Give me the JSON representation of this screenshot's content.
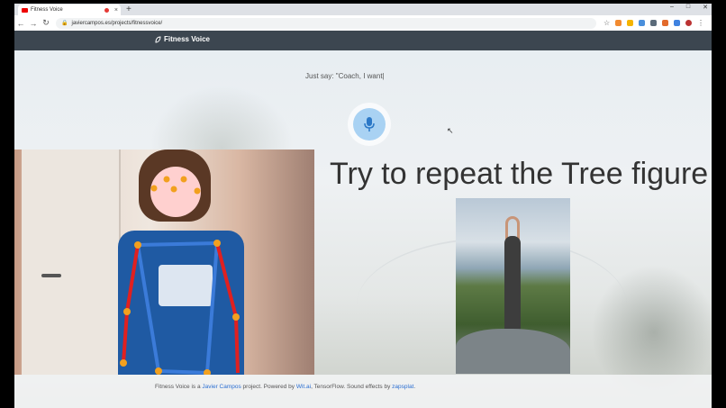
{
  "browser": {
    "tab_title": "Fitness Voice",
    "tab_close": "×",
    "new_tab": "+",
    "url": "javiercampos.es/projects/fitnessvoice/",
    "window_controls": [
      "–",
      "□",
      "✕"
    ]
  },
  "navbar": {
    "brand": "Fitness Voice"
  },
  "main": {
    "prompt": "Just say: \"Coach, I want|",
    "title": "Try to repeat the Tree figure"
  },
  "footer": {
    "text_1": "Fitness Voice is a ",
    "link_author": "Javier Campos",
    "text_2": " project. Powered by ",
    "link_wit": "Wit.ai",
    "text_3": ", TensorFlow. Sound effects by ",
    "link_zapsplat": "zapsplat",
    "text_4": "."
  },
  "colors": {
    "navbar": "#3c4650",
    "mic": "#a9d2f3",
    "skeleton_blue": "#3b7bd9",
    "skeleton_red": "#e02020",
    "keypoint": "#f2a01e",
    "link": "#2b6fd1"
  },
  "icons": [
    "microphone-icon",
    "leaf-icon",
    "lock-icon",
    "back-icon",
    "forward-icon",
    "reload-icon",
    "star-icon"
  ]
}
